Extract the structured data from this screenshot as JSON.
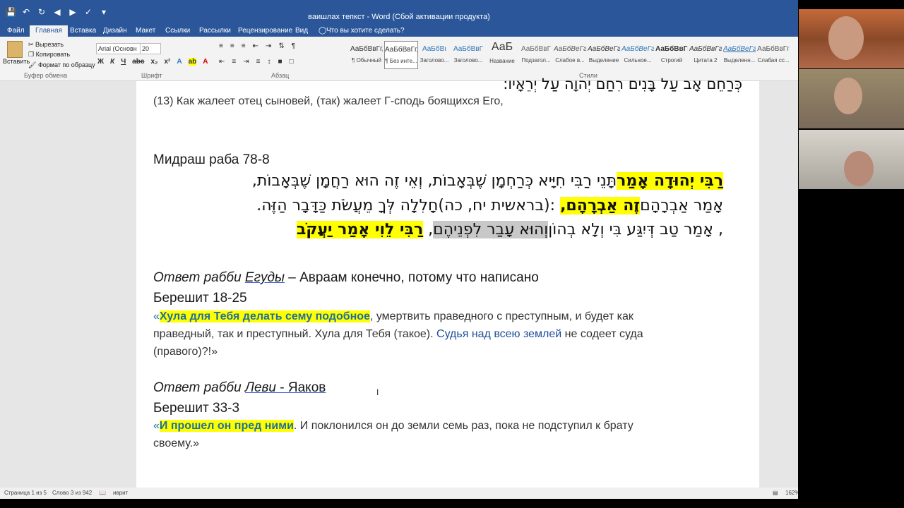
{
  "window": {
    "title": "ваишлах тепкст - Word (Сбой активации продукта)"
  },
  "menu": {
    "tabs": [
      "Файл",
      "Главная",
      "Вставка",
      "Дизайн",
      "Макет",
      "Ссылки",
      "Рассылки",
      "Рецензирование",
      "Вид"
    ],
    "tell_me": "Что вы хотите сделать?"
  },
  "ribbon": {
    "paste": "Вставить",
    "cut": "Вырезать",
    "copy": "Копировать",
    "format_painter": "Формат по образцу",
    "clipboard_group": "Буфер обмена",
    "font_name": "Arial (Основн",
    "font_size": "20",
    "font_group": "Шрифт",
    "paragraph_group": "Абзац",
    "styles_group": "Стили",
    "styles": [
      {
        "sample": "АаБбВвГг,",
        "name": "¶ Обычный"
      },
      {
        "sample": "АаБбВвГг,",
        "name": "¶ Без инте..."
      },
      {
        "sample": "АаБбВı",
        "name": "Заголово..."
      },
      {
        "sample": "АаБбВвГ",
        "name": "Заголово..."
      },
      {
        "sample": "АаБ",
        "name": "Название"
      },
      {
        "sample": "АаБбВвГ",
        "name": "Подзагол..."
      },
      {
        "sample": "АаБбВеГг",
        "name": "Слабое в..."
      },
      {
        "sample": "АаБбВеГг",
        "name": "Выделение"
      },
      {
        "sample": "АаБбВеГг",
        "name": "Сильное..."
      },
      {
        "sample": "АаБбВвГг,",
        "name": "Строгий"
      },
      {
        "sample": "АаБбВвГг",
        "name": "Цитата 2"
      },
      {
        "sample": "АаБбВеГг",
        "name": "Выделенн..."
      },
      {
        "sample": "АаБбВвГг",
        "name": "Слабая сс..."
      }
    ]
  },
  "document": {
    "hebrew_top": "כְּרַחֵם אָב עַל בָּנִים רִחַם יְהוָה עַל יְרֵאָיו:",
    "verse13": "(13) Как жалеет отец сыновей, (так) жалеет Г-сподь боящихся Его,",
    "midrash_title": "Мидраш раба 78-8",
    "heb1_a": "תָּנֵי רַבִּי חִיָּיא כְּרַחְמָן שֶׁבְּאָבוֹת, וְאֵי זֶה הוּא רַחֲמָן שֶׁבְּאָבוֹת, ",
    "heb1_hl": "רַבִּי יְהוּדָה אָמַר",
    "heb2_a": "חָלִלָה לְּךָ מֵעֲשֹׂת כַּדָּבָר הַזֶּה. ",
    "heb2_hl1": " :(בראשית יח, כה)",
    "heb2_hl2": "זֶה אַבְרָהָם,",
    "heb2_b": " אָמַר אַבְרָהָם",
    "heb3_hl": "רַבִּי לֵוִי אָמַר יַעֲקֹב",
    "heb3_a": ", ",
    "heb3_gray": "וְהוּא עָבַר לִפְנֵיהֶם",
    "heb3_b": ", אָמַר טַב דְּיִגַּע בִּי וְלָא בְהוֹן",
    "answer1_italic": "Ответ рабби ",
    "answer1_name": "Егуды",
    "answer1_rest": " – Авраам конечно, потому что написано",
    "ref1": "Берешит 18-25",
    "quote1_open": "«",
    "quote1_hl": "Хула для Тебя делать сему подобное",
    "quote1_rest1": ", умертвить праведного с преступным, и будет как",
    "quote1_line2a": "праведный, так и преступный. Хула для Тебя (такое). ",
    "quote1_blue": "Судья над всею землей",
    "quote1_line2b": " не содеет суда",
    "quote1_line3": "(правого)?!»",
    "answer2_italic": "Ответ рабби ",
    "answer2_name": "Леви",
    "answer2_rest": "  - Яаков",
    "ref2": "Берешит 33-3",
    "quote2_open": "«",
    "quote2_hl": "И прошел он пред ними",
    "quote2_rest": ". И поклонился он до земли семь раз, пока не подступил к брату",
    "quote2_line2": "своему.»"
  },
  "status": {
    "page": "Страница 1 из 5",
    "words": "Слово 3 из 942",
    "language": "иврит",
    "zoom": "162%"
  },
  "colors": {
    "word_blue": "#2b579a",
    "highlight_yellow": "#ffff00",
    "highlight_gray": "#c8c8c8",
    "link_blue": "#1f4e9b"
  }
}
